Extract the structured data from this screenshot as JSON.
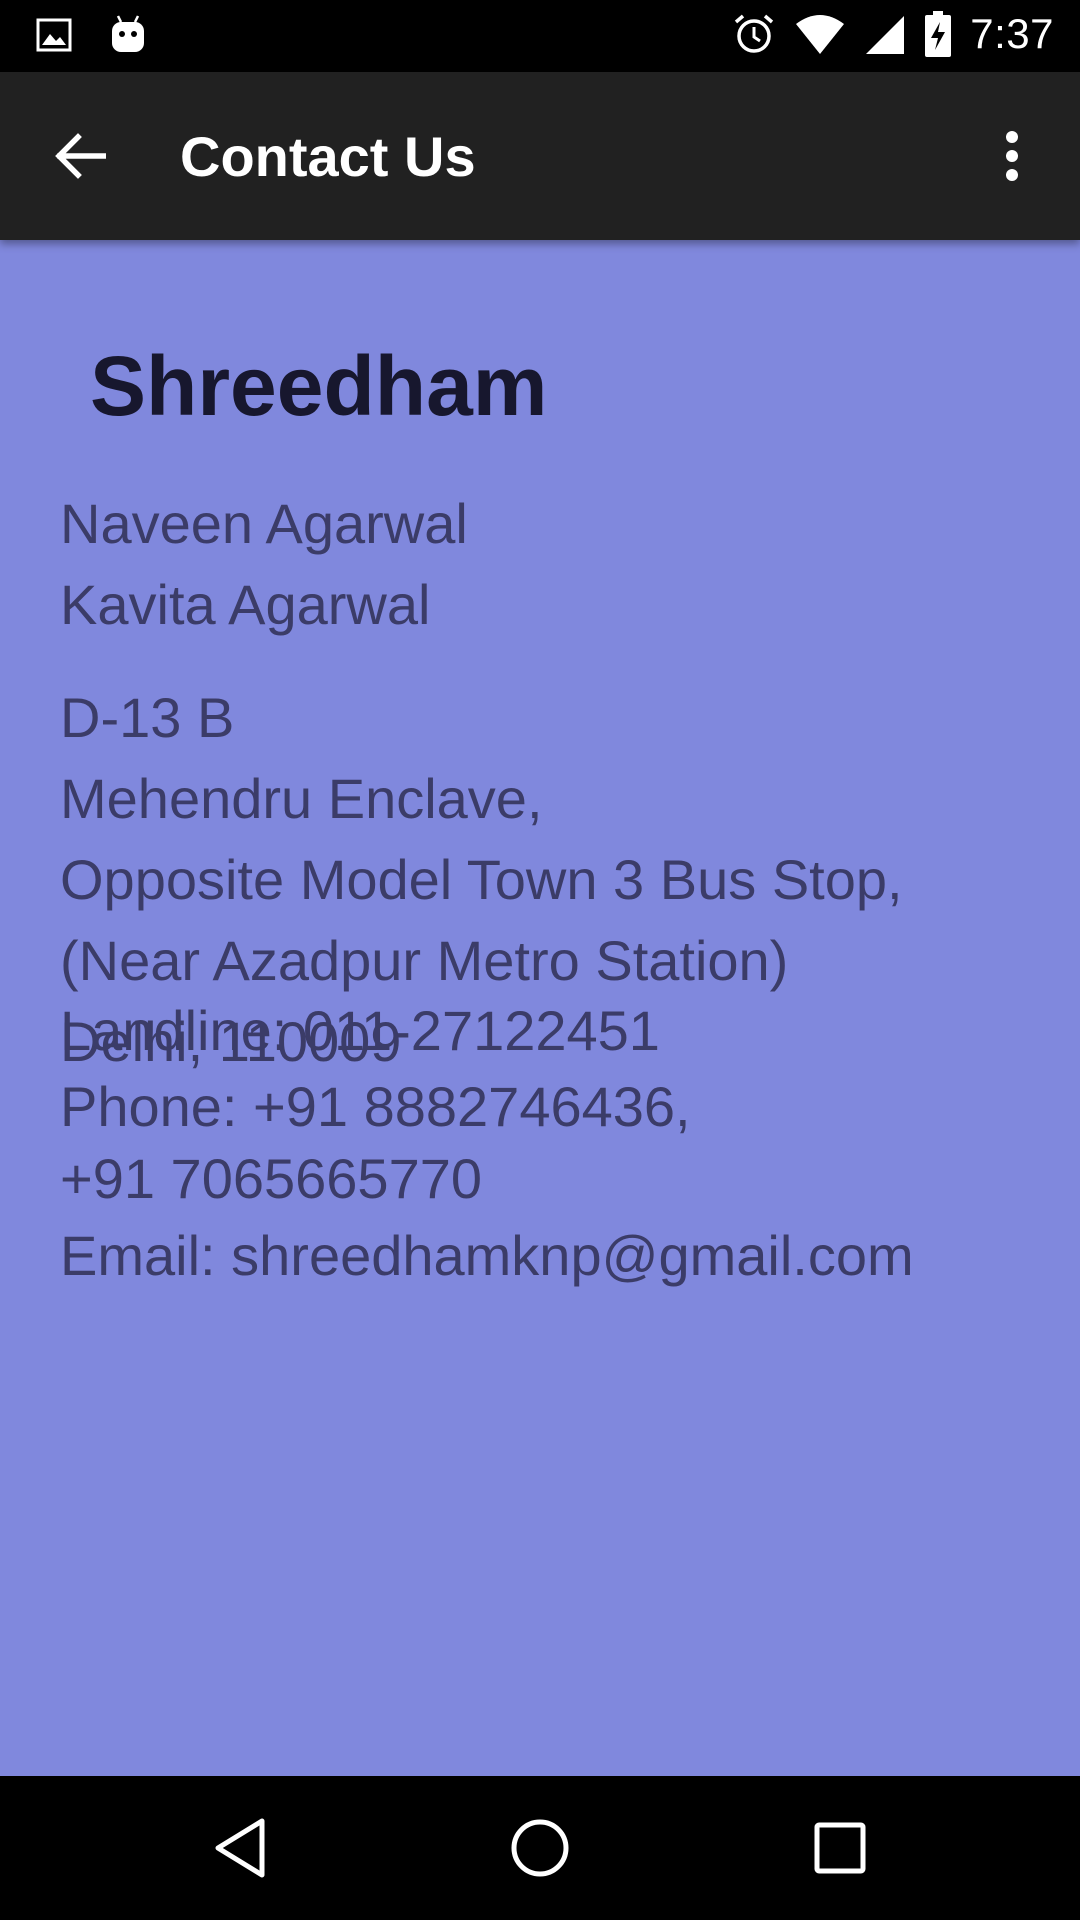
{
  "status_bar": {
    "time": "7:37",
    "left_icons": [
      "image-icon",
      "android-debug-icon"
    ],
    "right_icons": [
      "alarm-icon",
      "wifi-icon",
      "cell-signal-icon",
      "battery-charging-icon"
    ]
  },
  "app_bar": {
    "title": "Contact Us",
    "back_icon": "arrow-back-icon",
    "menu_icon": "overflow-menu-icon"
  },
  "contact": {
    "name": "Shreedham",
    "people": [
      "Naveen Agarwal",
      "Kavita Agarwal"
    ],
    "address_lines": [
      "D-13 B",
      "Mehendru Enclave,",
      "Opposite Model Town 3 Bus Stop,",
      "(Near Azadpur Metro Station)",
      "Delhi, 110009"
    ],
    "landline": "Landline: 011-27122451",
    "phone_line1": "Phone: +91 8882746436,",
    "phone_line2": "+91 7065665770",
    "email": "Email: shreedhamknp@gmail.com"
  },
  "colors": {
    "content_background": "#8088dd",
    "app_bar": "#212121",
    "heading_text": "#17172e",
    "body_text": "#3b3c68"
  },
  "nav_bar": {
    "icons": [
      "nav-back-icon",
      "nav-home-icon",
      "nav-recents-icon"
    ]
  }
}
